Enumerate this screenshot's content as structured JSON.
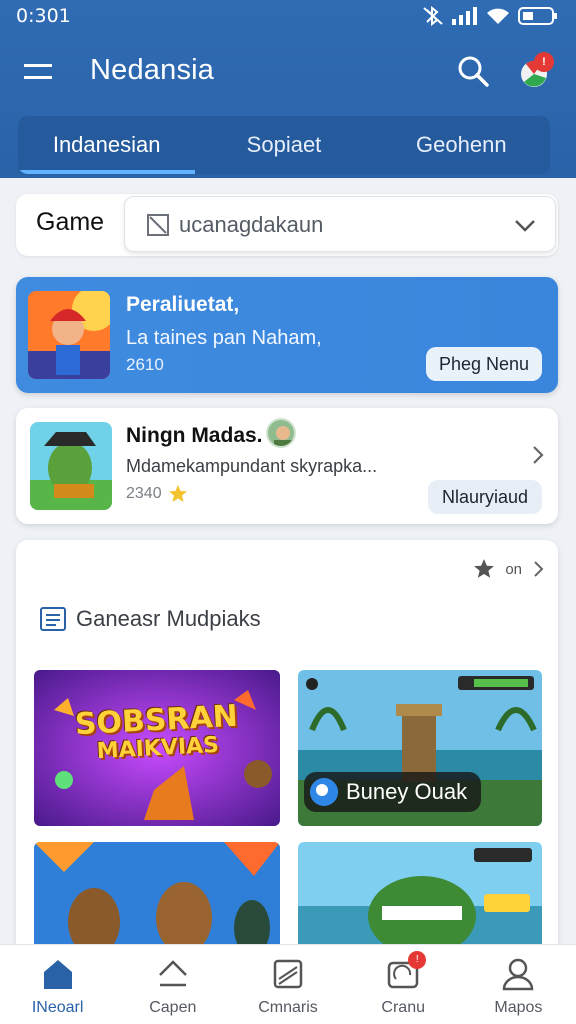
{
  "status_bar": {
    "time": "0:301"
  },
  "app_bar": {
    "title": "Nedansia",
    "notification_badge": "!"
  },
  "tabs": [
    {
      "label": "Indanesian",
      "active": true
    },
    {
      "label": "Sopiaet",
      "active": false
    },
    {
      "label": "Geohenn",
      "active": false
    }
  ],
  "filter": {
    "label": "Game",
    "value": "ucanagdakaun"
  },
  "featured_card": {
    "title": "Peraliuetat,",
    "subtitle": "La taines pan Naham,",
    "meta": "2610",
    "button_label": "Pheg Nenu"
  },
  "game_card": {
    "title": "Ningn Madas.",
    "description": "Mdamekampundant skyrapka...",
    "rating": "2340",
    "button_label": "Nlauryiaud"
  },
  "section": {
    "action_label": "on",
    "title": "Ganeasr Mudpiaks",
    "tiles": [
      {
        "art_text_line1": "SOBSRAN",
        "art_text_line2": "MAIKVIAS"
      },
      {
        "chip_label": "Buney Ouak"
      },
      {},
      {}
    ]
  },
  "bottom_nav": [
    {
      "label": "INeoarl",
      "icon": "home-icon",
      "active": true
    },
    {
      "label": "Capen",
      "icon": "upload-icon",
      "active": false
    },
    {
      "label": "Cmnaris",
      "icon": "library-icon",
      "active": false
    },
    {
      "label": "Cranu",
      "icon": "messages-icon",
      "active": false,
      "badge": "!"
    },
    {
      "label": "Mapos",
      "icon": "profile-icon",
      "active": false
    }
  ],
  "colors": {
    "header": "#2f6cb4",
    "accent": "#3f8be0",
    "badge": "#e53935",
    "active_tab_indicator": "#63b2ff"
  }
}
